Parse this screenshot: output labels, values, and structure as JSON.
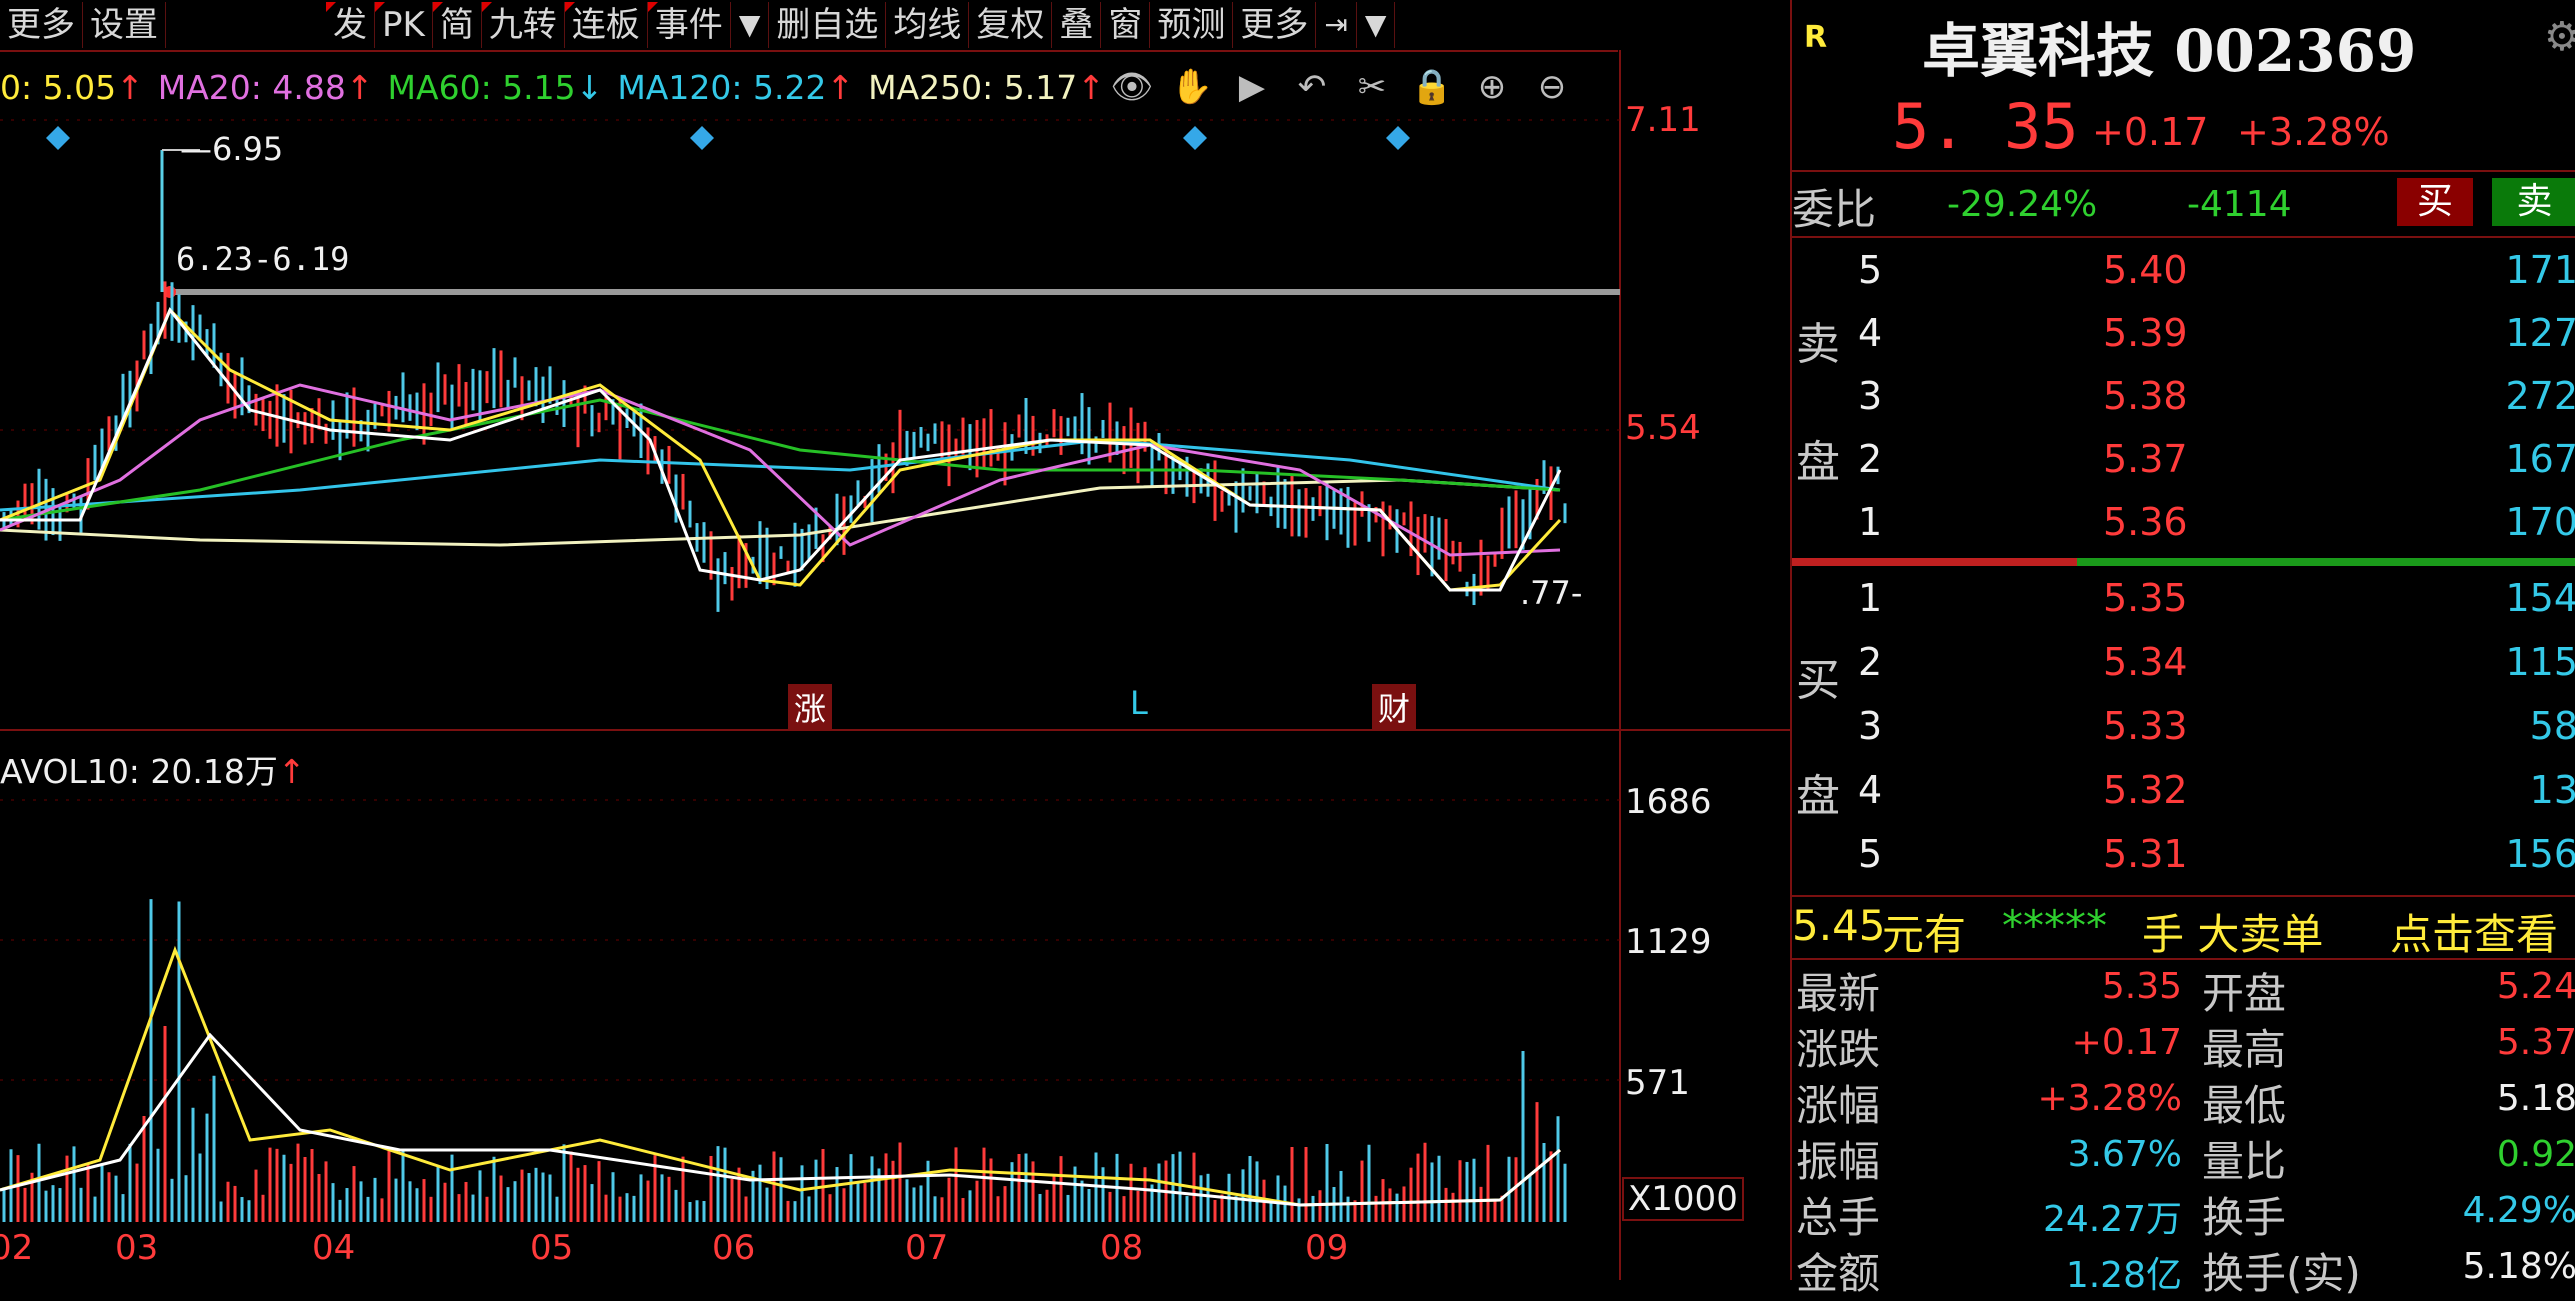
{
  "toolbar": {
    "left": [
      "更多",
      "设置"
    ],
    "right": [
      "发",
      "PK",
      "简",
      "九转",
      "连板",
      "事件"
    ],
    "right2": [
      "删自选",
      "均线",
      "复权",
      "叠",
      "窗",
      "预测",
      "更多"
    ]
  },
  "ma": {
    "ma10": "0: 5.05",
    "ma20": "MA20: 4.88",
    "ma60": "MA60: 5.15",
    "ma120": "MA120: 5.22",
    "ma250": "MA250: 5.17",
    "up": "↑",
    "down": "↓"
  },
  "price_chart": {
    "high_label": "6.95",
    "range_label": "6.23-6.19",
    "low_label": ".77-",
    "axis": [
      "7.11",
      "5.54"
    ],
    "markers": [
      "涨",
      "L",
      "财"
    ]
  },
  "vol_chart": {
    "title": "AVOL10: 20.18万",
    "axis": [
      "1686",
      "1129",
      "571",
      "X1000"
    ],
    "months": [
      "02",
      "03",
      "04",
      "05",
      "06",
      "07",
      "08",
      "09"
    ]
  },
  "stock": {
    "r_badge": "R",
    "name": "卓翼科技 002369",
    "price": "5. 35",
    "change": "+0.17",
    "pct": "+3.28%",
    "weibi_label": "委比",
    "weibi_pct": "-29.24%",
    "weibi_val": "-4114",
    "buy_btn": "买",
    "sell_btn": "卖",
    "sell_label_1": "卖",
    "sell_label_2": "盘",
    "buy_label_1": "买",
    "buy_label_2": "盘",
    "asks": [
      {
        "lvl": "5",
        "p": "5.40",
        "v": "171"
      },
      {
        "lvl": "4",
        "p": "5.39",
        "v": "127"
      },
      {
        "lvl": "3",
        "p": "5.38",
        "v": "272"
      },
      {
        "lvl": "2",
        "p": "5.37",
        "v": "167"
      },
      {
        "lvl": "1",
        "p": "5.36",
        "v": "170"
      }
    ],
    "bids": [
      {
        "lvl": "1",
        "p": "5.35",
        "v": "154"
      },
      {
        "lvl": "2",
        "p": "5.34",
        "v": "115"
      },
      {
        "lvl": "3",
        "p": "5.33",
        "v": "58"
      },
      {
        "lvl": "4",
        "p": "5.32",
        "v": "13"
      },
      {
        "lvl": "5",
        "p": "5.31",
        "v": "156"
      }
    ],
    "bigorder": {
      "price": "5.45",
      "t1": "元有",
      "stars": "*****",
      "t2": "手 大卖单",
      "link": "点击查看"
    },
    "stats": [
      {
        "k": "最新",
        "v": "5.35",
        "k2": "开盘",
        "v2": "5.24"
      },
      {
        "k": "涨跌",
        "v": "+0.17",
        "k2": "最高",
        "v2": "5.37"
      },
      {
        "k": "涨幅",
        "v": "+3.28%",
        "k2": "最低",
        "v2": "5.18"
      },
      {
        "k": "振幅",
        "v": "3.67%",
        "k2": "量比",
        "v2": "0.92"
      },
      {
        "k": "总手",
        "v": "24.27万",
        "k2": "换手",
        "v2": "4.29%"
      },
      {
        "k": "金额",
        "v": "1.28亿",
        "k2": "换手(实)",
        "v2": "5.18%"
      }
    ]
  }
}
